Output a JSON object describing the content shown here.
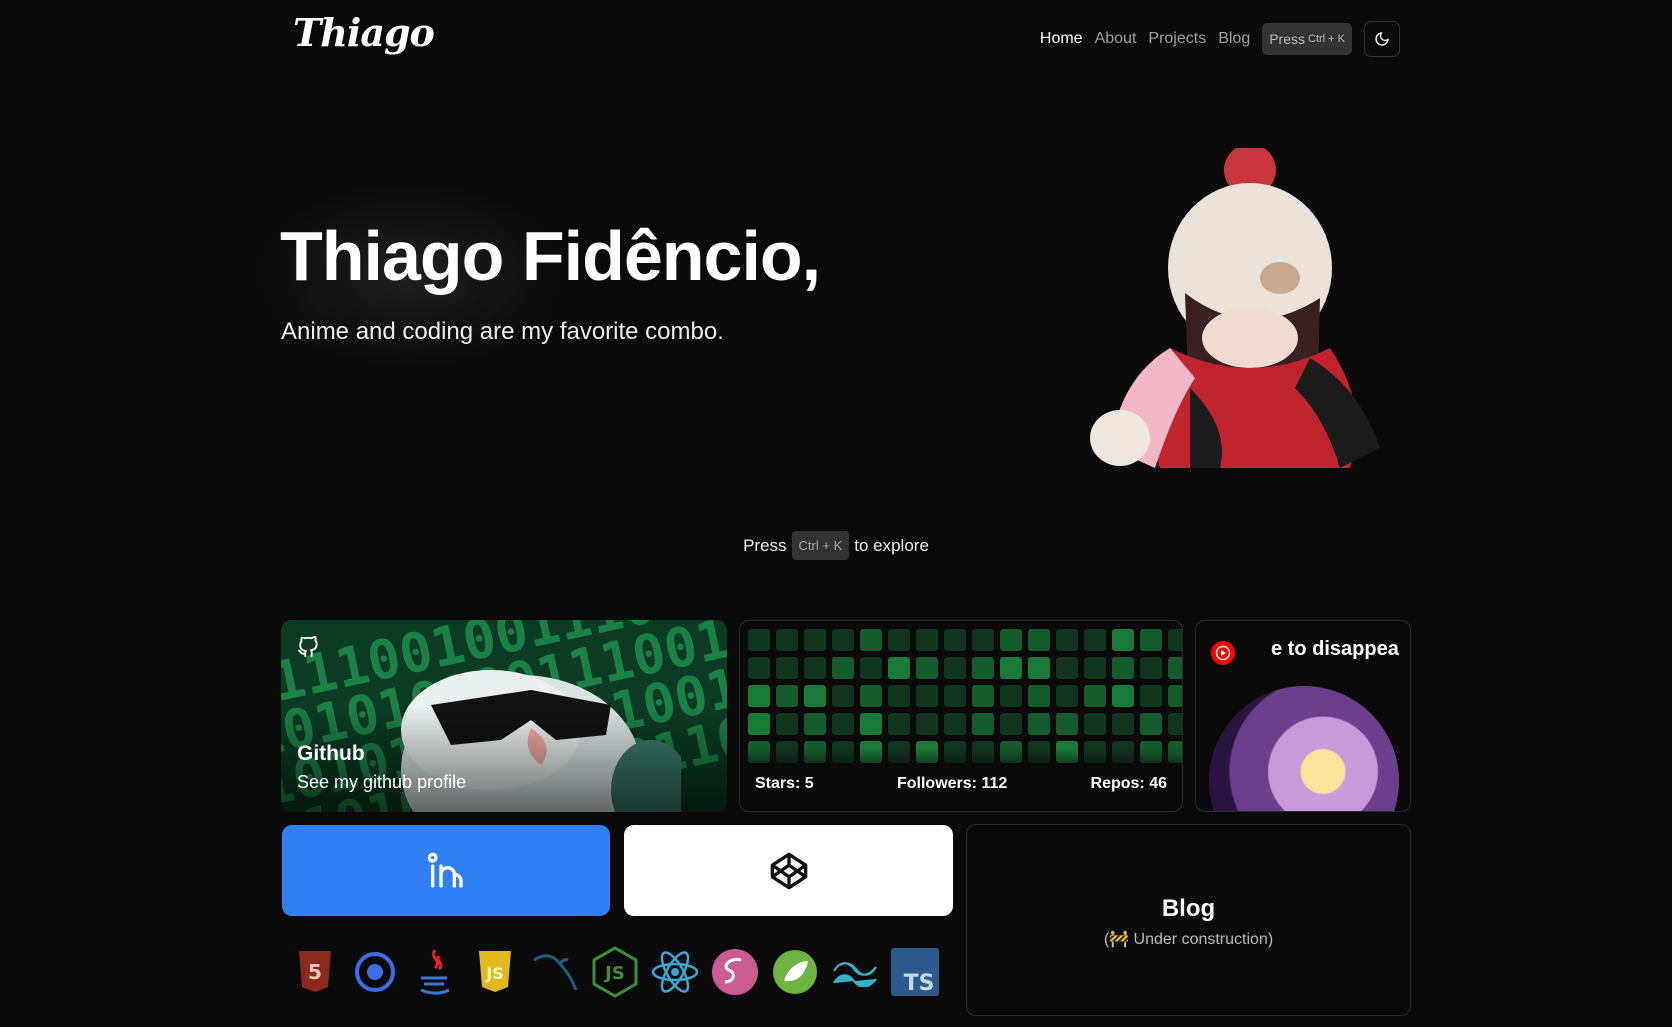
{
  "header": {
    "logo": "Thiago",
    "nav": [
      {
        "label": "Home",
        "active": true
      },
      {
        "label": "About",
        "active": false
      },
      {
        "label": "Projects",
        "active": false
      },
      {
        "label": "Blog",
        "active": false
      }
    ],
    "command_button": {
      "prefix": "Press",
      "shortcut": "Ctrl + K"
    },
    "theme_toggle_icon": "moon-icon"
  },
  "hero": {
    "title": "Thiago Fidêncio,",
    "subtitle": "Anime and coding are my favorite combo."
  },
  "explore": {
    "before": "Press",
    "shortcut": "Ctrl + K",
    "after": "to explore"
  },
  "github_card": {
    "title": "Github",
    "subtitle": "See my github profile",
    "binary_rows": [
      "0111001001110",
      "1010101001110011",
      "1010110100010011",
      "0101000011001101"
    ]
  },
  "stats": {
    "stars": "Stars: 5",
    "followers": "Followers: 112",
    "repos": "Repos: 46"
  },
  "youtube_card": {
    "title": "e to disappea"
  },
  "blog_card": {
    "title": "Blog",
    "subtitle": "(🚧 Under construction)"
  },
  "tech_icons": [
    "html5-icon",
    "ionic-icon",
    "java-icon",
    "javascript-icon",
    "mysql-icon",
    "nodejs-icon",
    "react-icon",
    "sass-icon",
    "spring-icon",
    "tailwind-icon",
    "typescript-icon"
  ],
  "colors": {
    "background": "#0a0a0a",
    "linkedin": "#2f7ff7",
    "codepen": "#ffffff",
    "contribution_levels": [
      "#0d2818",
      "#10361f",
      "#145c2c",
      "#1a7a37",
      "#2a9c44"
    ]
  }
}
